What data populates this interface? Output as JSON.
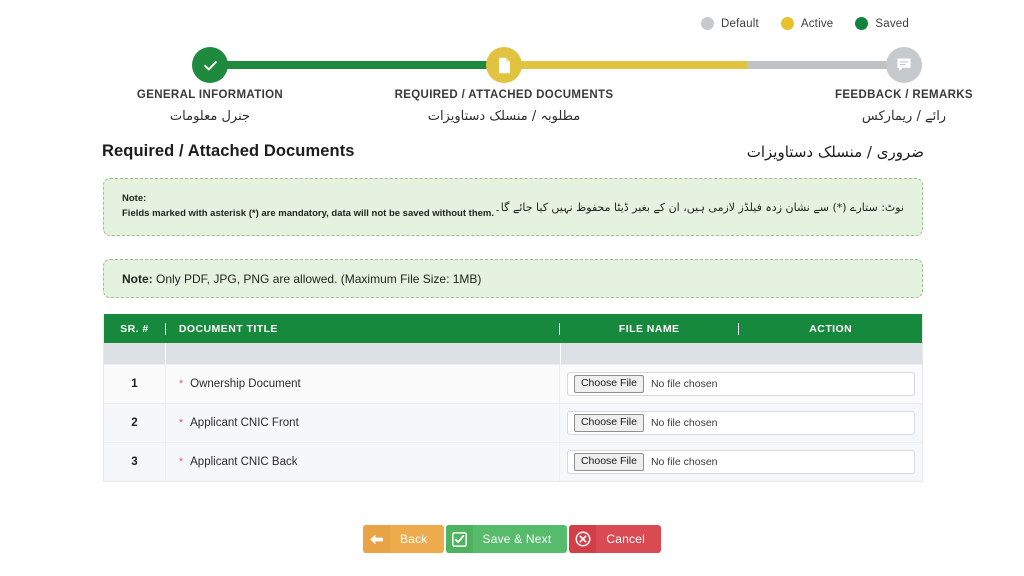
{
  "legend": {
    "items": [
      {
        "label": "Default",
        "color": "#c7cacc",
        "icon": "circle-dot-icon"
      },
      {
        "label": "Active",
        "color": "#e8c22e",
        "icon": "circle-dot-icon"
      },
      {
        "label": "Saved",
        "color": "#11833a",
        "icon": "circle-dot-icon"
      }
    ]
  },
  "stepper": {
    "steps": [
      {
        "en": "GENERAL INFORMATION",
        "ur": "جنرل معلومات",
        "state": "Saved",
        "color": "#1d8a3e",
        "icon": "check-icon"
      },
      {
        "en": "REQUIRED / ATTACHED DOCUMENTS",
        "ur": "مطلوبہ / منسلک دستاویزات",
        "state": "Active",
        "color": "#e2c341",
        "icon": "document-icon"
      },
      {
        "en": "FEEDBACK / REMARKS",
        "ur": "رائے / ریمارکس",
        "state": "Default",
        "color": "#c7cacc",
        "icon": "comment-icon"
      }
    ],
    "connectors": [
      {
        "from": "GENERAL INFORMATION",
        "color": "#1d8a3e"
      },
      {
        "from": "REQUIRED / ATTACHED DOCUMENTS",
        "color": "#e2c341"
      },
      {
        "from": "FEEDBACK / REMARKS",
        "color": "#bfc2c4"
      }
    ]
  },
  "header": {
    "title_en": "Required / Attached Documents",
    "title_ur": "ضروری / منسلک دستاویزات"
  },
  "notes": {
    "mandatory": {
      "en_line1": "Note:",
      "en_line2": "Fields marked with asterisk (*) are mandatory, data will not be saved without them.",
      "ur": "نوٹ: ستارے (*) سے نشان زدہ فیلڈز لازمی ہیں، ان کے بغیر ڈیٹا محفوظ نہیں کیا جائے گا۔"
    },
    "filetypes": {
      "label": "Note:",
      "text": " Only PDF, JPG, PNG are allowed. (Maximum File Size: 1MB)"
    }
  },
  "table": {
    "columns": [
      "SR. #",
      "DOCUMENT TITLE",
      "FILE NAME",
      "ACTION"
    ],
    "rows": [
      {
        "sr": "1",
        "required_marker": "*",
        "title": "Ownership Document",
        "choose_label": "Choose File",
        "file_status": "No file chosen"
      },
      {
        "sr": "2",
        "required_marker": "*",
        "title": "Applicant CNIC Front",
        "choose_label": "Choose File",
        "file_status": "No file chosen"
      },
      {
        "sr": "3",
        "required_marker": "*",
        "title": "Applicant CNIC Back",
        "choose_label": "Choose File",
        "file_status": "No file chosen"
      }
    ]
  },
  "footer": {
    "back": {
      "label": "Back",
      "icon": "arrow-left-icon",
      "color": "#eeab4e"
    },
    "save": {
      "label": "Save & Next",
      "icon": "checkbox-icon",
      "color": "#56bb6a"
    },
    "cancel": {
      "label": "Cancel",
      "icon": "close-circle-icon",
      "color": "#da4a52"
    }
  }
}
